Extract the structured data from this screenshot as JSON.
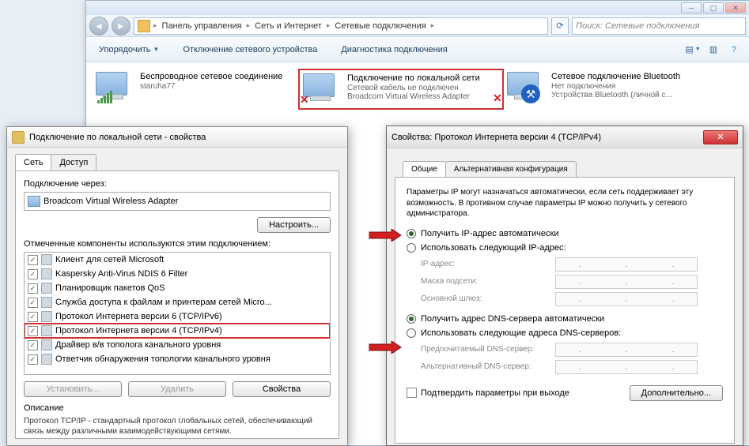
{
  "explorer": {
    "breadcrumbs": [
      "Панель управления",
      "Сеть и Интернет",
      "Сетевые подключения"
    ],
    "search_placeholder": "Поиск: Сетевые подключения",
    "toolbar": {
      "organize": "Упорядочить",
      "disable": "Отключение сетевого устройства",
      "diagnose": "Диагностика подключения"
    },
    "connections": [
      {
        "title": "Беспроводное сетевое соединение",
        "sub1": "staruha77",
        "sub2": ""
      },
      {
        "title": "Подключение по локальной сети",
        "sub1": "Сетевой кабель не подключен",
        "sub2": "Broadcom Virtual Wireless Adapter"
      },
      {
        "title": "Сетевое подключение Bluetooth",
        "sub1": "Нет подключения",
        "sub2": "Устройства Bluetooth (личной с..."
      }
    ]
  },
  "propdlg": {
    "title": "Подключение по локальной сети - свойства",
    "tabs": [
      "Сеть",
      "Доступ"
    ],
    "connect_via_label": "Подключение через:",
    "adapter": "Broadcom Virtual Wireless Adapter",
    "configure_btn": "Настроить...",
    "components_label": "Отмеченные компоненты используются этим подключением:",
    "components": [
      "Клиент для сетей Microsoft",
      "Kaspersky Anti-Virus NDIS 6 Filter",
      "Планировщик пакетов QoS",
      "Служба доступа к файлам и принтерам сетей Micro...",
      "Протокол Интернета версии 6 (TCP/IPv6)",
      "Протокол Интернета версии 4 (TCP/IPv4)",
      "Драйвер в/в тополога канального уровня",
      "Ответчик обнаружения топологии канального уровня"
    ],
    "install_btn": "Установить...",
    "uninstall_btn": "Удалить",
    "props_btn": "Свойства",
    "desc_title": "Описание",
    "desc_text": "Протокол TCP/IP - стандартный протокол глобальных сетей, обеспечивающий связь между различными взаимодействующими сетями."
  },
  "ipdlg": {
    "title": "Свойства: Протокол Интернета версии 4 (TCP/IPv4)",
    "tabs": [
      "Общие",
      "Альтернативная конфигурация"
    ],
    "desc": "Параметры IP могут назначаться автоматически, если сеть поддерживает эту возможность. В противном случае параметры IP можно получить у сетевого администратора.",
    "radio_ip_auto": "Получить IP-адрес автоматически",
    "radio_ip_manual": "Использовать следующий IP-адрес:",
    "lbl_ip": "IP-адрес:",
    "lbl_mask": "Маска подсети:",
    "lbl_gateway": "Основной шлюз:",
    "radio_dns_auto": "Получить адрес DNS-сервера автоматически",
    "radio_dns_manual": "Использовать следующие адреса DNS-серверов:",
    "lbl_dns1": "Предпочитаемый DNS-сервер:",
    "lbl_dns2": "Альтернативный DNS-сервер:",
    "validate": "Подтвердить параметры при выходе",
    "advanced": "Дополнительно..."
  }
}
